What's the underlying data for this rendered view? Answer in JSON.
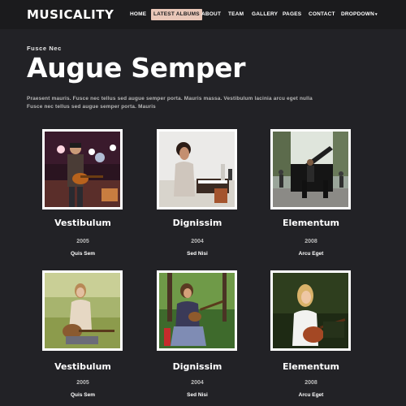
{
  "brand": {
    "logo": "MUSICALITY"
  },
  "nav": {
    "items": [
      "HOME",
      "LATEST ALBUMS",
      "ABOUT",
      "TEAM",
      "GALLERY",
      "PAGES",
      "CONTACT",
      "DROPDOWN"
    ],
    "active": "LATEST ALBUMS",
    "caret": "▾"
  },
  "hero": {
    "eyebrow": "Fusce Nec",
    "title": "Augue Semper",
    "text": "Praesent mauris. Fusce nec tellus sed augue semper porta. Mauris massa. Vestibulum lacinia arcu eget nulla Fusce nec tellus sed augue semper porta. Mauris"
  },
  "albums": [
    {
      "title": "Vestibulum",
      "year": "2005",
      "sub": "Quis Sem",
      "photo": "guitarist-on-stage"
    },
    {
      "title": "Dignissim",
      "year": "2004",
      "sub": "Sed Nisi",
      "photo": "woman-with-headphones"
    },
    {
      "title": "Elementum",
      "year": "2008",
      "sub": "Arcu Eget",
      "photo": "street-pianist"
    },
    {
      "title": "Vestibulum",
      "year": "2005",
      "sub": "Quis Sem",
      "photo": "girl-guitar-field"
    },
    {
      "title": "Dignissim",
      "year": "2004",
      "sub": "Sed Nisi",
      "photo": "woman-mandolin-forest"
    },
    {
      "title": "Elementum",
      "year": "2008",
      "sub": "Arcu Eget",
      "photo": "blonde-guitarist"
    }
  ],
  "colors": {
    "background": "#222226",
    "topbar": "#1b1b1d",
    "active_nav": "#e9c7b8"
  }
}
